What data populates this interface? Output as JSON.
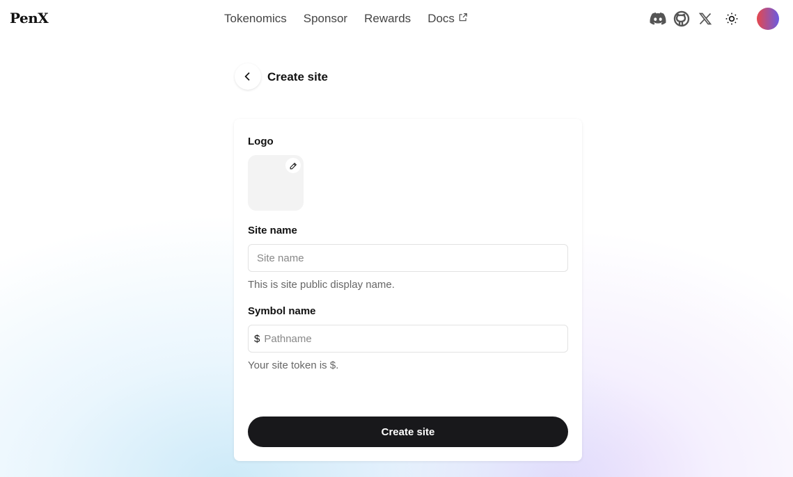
{
  "nav": {
    "logo": "PenX",
    "links": [
      "Tokenomics",
      "Sponsor",
      "Rewards",
      "Docs"
    ]
  },
  "page": {
    "title": "Create site"
  },
  "form": {
    "logo_label": "Logo",
    "site_name_label": "Site name",
    "site_name_placeholder": "Site name",
    "site_name_help": "This is site public display name.",
    "symbol_label": "Symbol name",
    "symbol_prefix": "$",
    "symbol_placeholder": "Pathname",
    "symbol_help": "Your site token is $.",
    "submit": "Create site"
  }
}
